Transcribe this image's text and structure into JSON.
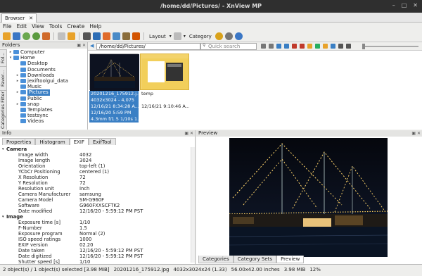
{
  "window": {
    "title": "/home/dd/Pictures/ - XnView MP"
  },
  "doc_tab": {
    "label": "Browser",
    "close": "✕"
  },
  "menu": [
    "File",
    "Edit",
    "View",
    "Tools",
    "Create",
    "Help"
  ],
  "toolbar": {
    "layout_label": "Layout",
    "category_label": "Category"
  },
  "folders": {
    "title": "Folders",
    "vtabs": [
      "Fol...",
      "Favor...",
      "Categories Filter"
    ],
    "items": [
      {
        "label": "Computer",
        "indent": 0,
        "arrow": "▸"
      },
      {
        "label": "Home",
        "indent": 0,
        "arrow": "▾"
      },
      {
        "label": "Desktop",
        "indent": 1,
        "arrow": ""
      },
      {
        "label": "Documents",
        "indent": 1,
        "arrow": ""
      },
      {
        "label": "Downloads",
        "indent": 1,
        "arrow": "▸"
      },
      {
        "label": "jexiftoolgui_data",
        "indent": 1,
        "arrow": "▸"
      },
      {
        "label": "Music",
        "indent": 1,
        "arrow": ""
      },
      {
        "label": "Pictures",
        "indent": 1,
        "arrow": "▸",
        "selected": true
      },
      {
        "label": "Public",
        "indent": 1,
        "arrow": ""
      },
      {
        "label": "snap",
        "indent": 1,
        "arrow": "▸"
      },
      {
        "label": "Templates",
        "indent": 1,
        "arrow": ""
      },
      {
        "label": "testsync",
        "indent": 1,
        "arrow": ""
      },
      {
        "label": "Videos",
        "indent": 1,
        "arrow": ""
      }
    ]
  },
  "browser": {
    "path": "/home/dd/Pictures/",
    "search_placeholder": "Quick search",
    "thumbnails": [
      {
        "selected": true,
        "captions": [
          "20201216_175912.j...",
          "4032x3024 - 4,075",
          "12/16/21 8:34:28 A...",
          "12/16/20 5:59 PM",
          "4.3mm f/1.5 1/10s 1..."
        ]
      },
      {
        "selected": false,
        "captions": [
          "temp",
          "",
          "12/16/21 9:10:46 A..."
        ]
      }
    ]
  },
  "info": {
    "title": "Info",
    "tabs": [
      "Properties",
      "Histogram",
      "EXIF",
      "ExifTool"
    ],
    "active_tab": "EXIF",
    "rows": [
      {
        "section": true,
        "k": "Camera",
        "v": ""
      },
      {
        "k": "Image width",
        "v": "4032"
      },
      {
        "k": "Image length",
        "v": "3024"
      },
      {
        "k": "Orientation",
        "v": "top-left (1)"
      },
      {
        "k": "YCbCr Positioning",
        "v": "centered (1)"
      },
      {
        "k": "X Resolution",
        "v": "72"
      },
      {
        "k": "Y Resolution",
        "v": "72"
      },
      {
        "k": "Resolution unit",
        "v": "Inch"
      },
      {
        "k": "Camera Manufacturer",
        "v": "samsung"
      },
      {
        "k": "Camera Model",
        "v": "SM-G960F"
      },
      {
        "k": "Software",
        "v": "G960FXXSCFTK2"
      },
      {
        "k": "Date modified",
        "v": "12/16/20 - 5:59:12 PM PST"
      },
      {
        "section": true,
        "k": "Image",
        "v": ""
      },
      {
        "k": "Exposure time [s]",
        "v": "1/10"
      },
      {
        "k": "F-Number",
        "v": "1.5"
      },
      {
        "k": "Exposure program",
        "v": "Normal (2)"
      },
      {
        "k": "ISO speed ratings",
        "v": "1000"
      },
      {
        "k": "EXIF version",
        "v": "02.20"
      },
      {
        "k": "Date taken",
        "v": "12/16/20 - 5:59:12 PM PST"
      },
      {
        "k": "Date digitized",
        "v": "12/16/20 - 5:59:12 PM PST"
      },
      {
        "k": "Shutter speed [s]",
        "v": "1/10"
      }
    ]
  },
  "preview": {
    "title": "Preview",
    "tabs": [
      "Categories",
      "Category Sets",
      "Preview"
    ],
    "active_tab": "Preview"
  },
  "status": {
    "selection": "2 object(s) / 1 object(s) selected [3.98 MiB]",
    "filename": "20201216_175912.jpg",
    "dimensions": "4032x3024x24 (1.33)",
    "print_size": "56.00x42.00 inches",
    "filesize": "3.98 MiB",
    "zoom": "12%"
  },
  "colors": {
    "selection": "#3a7fc4",
    "folder_icon": "#4a90d9",
    "titlebar": "#2f2f2f"
  }
}
